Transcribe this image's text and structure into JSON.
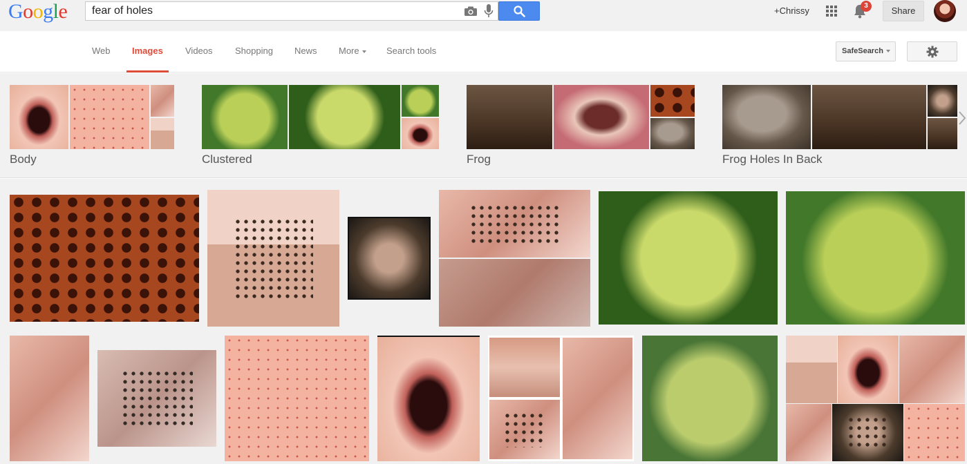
{
  "header": {
    "logo": [
      "G",
      "o",
      "o",
      "g",
      "l",
      "e"
    ],
    "search_value": "fear of holes",
    "search_icon": "search-icon",
    "camera_icon": "camera-icon",
    "mic_icon": "microphone-icon",
    "user_link": "+Chrissy",
    "notification_count": "3",
    "share_label": "Share"
  },
  "nav": {
    "tabs": [
      {
        "label": "Web"
      },
      {
        "label": "Images",
        "active": true
      },
      {
        "label": "Videos"
      },
      {
        "label": "Shopping"
      },
      {
        "label": "News"
      },
      {
        "label": "More"
      },
      {
        "label": "Search tools"
      }
    ],
    "safesearch_label": "SafeSearch",
    "settings_icon": "gear-icon"
  },
  "related": [
    {
      "label": "Body"
    },
    {
      "label": "Clustered"
    },
    {
      "label": "Frog"
    },
    {
      "label": "Frog Holes In Back"
    }
  ],
  "colors": {
    "accent_red": "#dd4b39",
    "search_blue": "#4d8af0",
    "background_grey": "#f1f1f1"
  }
}
